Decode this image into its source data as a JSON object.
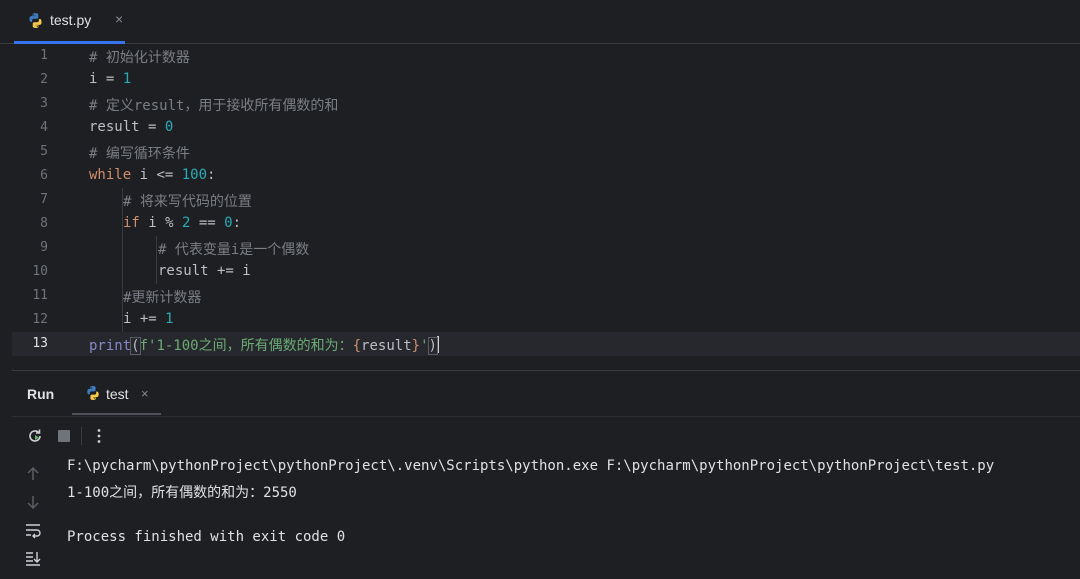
{
  "tab": {
    "filename": "test.py",
    "close": "×"
  },
  "editor": {
    "lines": [
      {
        "n": "1"
      },
      {
        "n": "2"
      },
      {
        "n": "3"
      },
      {
        "n": "4"
      },
      {
        "n": "5"
      },
      {
        "n": "6"
      },
      {
        "n": "7"
      },
      {
        "n": "8"
      },
      {
        "n": "9"
      },
      {
        "n": "10"
      },
      {
        "n": "11"
      },
      {
        "n": "12"
      },
      {
        "n": "13"
      }
    ],
    "code": {
      "l1": "# 初始化计数器",
      "l2_var": "i",
      "l2_op": " = ",
      "l2_num": "1",
      "l3": "# 定义result，用于接收所有偶数的和",
      "l4_var": "result",
      "l4_op": " = ",
      "l4_num": "0",
      "l5": "# 编写循环条件",
      "l6_kw": "while",
      "l6_mid": " i <= ",
      "l6_num": "100",
      "l6_end": ":",
      "l7": "# 将来写代码的位置",
      "l8_kw": "if",
      "l8_mid": " i % ",
      "l8_num1": "2",
      "l8_mid2": " == ",
      "l8_num2": "0",
      "l8_end": ":",
      "l9": "# 代表变量i是一个偶数",
      "l10": "result += i",
      "l11": "#更新计数器",
      "l12_mid": "i += ",
      "l12_num": "1",
      "l13_fn": "print",
      "l13_open": "(",
      "l13_str1": "f'1-100之间，所有偶数的和为：",
      "l13_lb": "{",
      "l13_var": "result",
      "l13_rb": "}",
      "l13_str2": "'",
      "l13_close": ")"
    }
  },
  "run": {
    "title": "Run",
    "tab_name": "test",
    "tab_close": "×",
    "output": [
      "F:\\pycharm\\pythonProject\\pythonProject\\.venv\\Scripts\\python.exe F:\\pycharm\\pythonProject\\pythonProject\\test.py",
      "1-100之间，所有偶数的和为：2550",
      "",
      "Process finished with exit code 0"
    ]
  },
  "colors": {
    "background": "#1e1f22",
    "keyword": "#cf8e6d",
    "number": "#2aacb8",
    "comment": "#7a7e85",
    "string": "#6aab73",
    "builtin": "#8888c6",
    "accent": "#3574f0"
  }
}
